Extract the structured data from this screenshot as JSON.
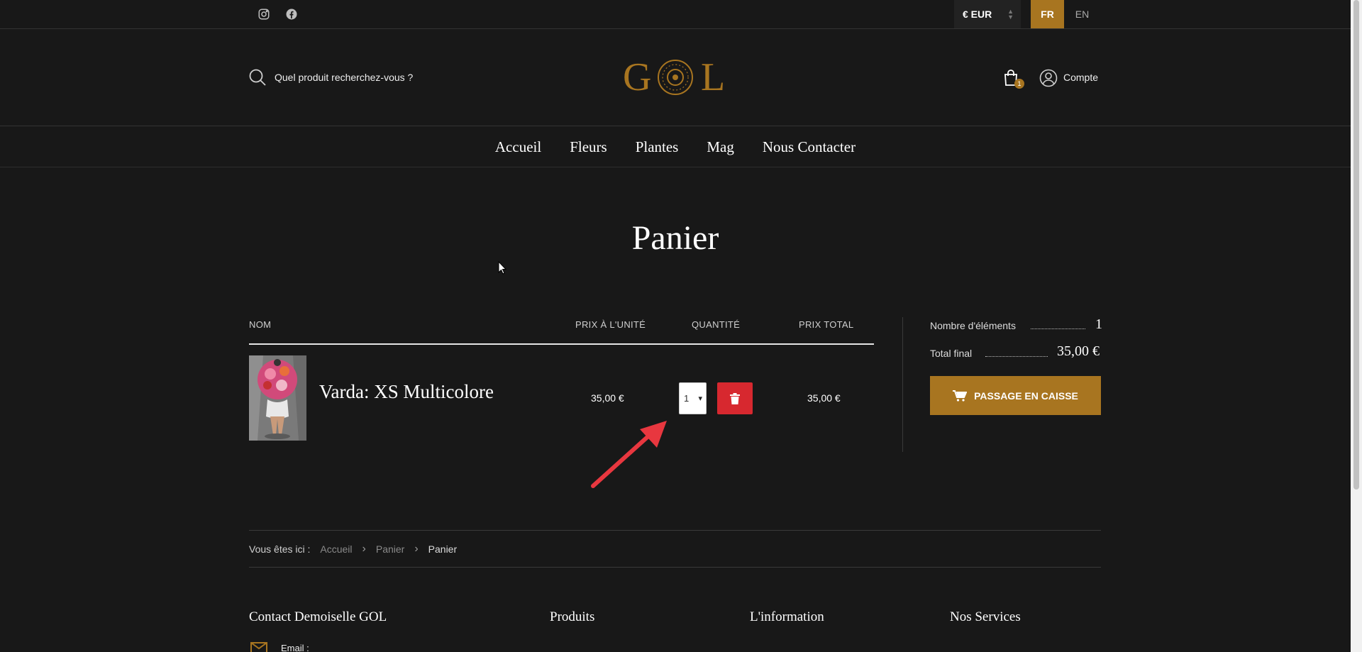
{
  "topbar": {
    "currency": "€ EUR",
    "languages": [
      "FR",
      "EN"
    ],
    "active_language": "FR"
  },
  "header": {
    "search_placeholder": "Quel produit recherchez-vous ?",
    "logo_text": "GOL",
    "cart_count": "1",
    "account_label": "Compte"
  },
  "nav": {
    "items": [
      "Accueil",
      "Fleurs",
      "Plantes",
      "Mag",
      "Nous Contacter"
    ]
  },
  "page": {
    "title": "Panier"
  },
  "cart": {
    "columns": {
      "name": "NOM",
      "unit_price": "PRIX À L'UNITÉ",
      "quantity": "QUANTITÉ",
      "total_price": "PRIX TOTAL"
    },
    "items": [
      {
        "name": "Varda: XS Multicolore",
        "unit_price": "35,00 €",
        "quantity": "1",
        "total_price": "35,00 €"
      }
    ]
  },
  "summary": {
    "items_label": "Nombre d'éléments",
    "items_value": "1",
    "total_label": "Total final",
    "total_value": "35,00 €",
    "checkout_label": "PASSAGE EN CAISSE"
  },
  "breadcrumb": {
    "prefix": "Vous êtes ici :",
    "items": [
      "Accueil",
      "Panier",
      "Panier"
    ]
  },
  "footer": {
    "contact_heading": "Contact Demoiselle GOL",
    "email_label": "Email :",
    "products_heading": "Produits",
    "info_heading": "L'information",
    "services_heading": "Nos Services"
  },
  "colors": {
    "background": "#181818",
    "accent": "#a87520",
    "delete": "#d7282f"
  }
}
